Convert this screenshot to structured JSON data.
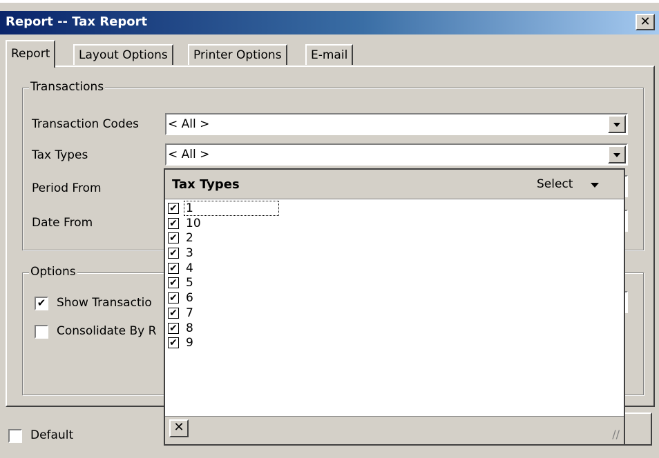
{
  "window": {
    "title": "Report -- Tax Report",
    "close_glyph": "✕"
  },
  "tabs": [
    {
      "label": "Report",
      "active": true
    },
    {
      "label": "Layout Options",
      "active": false
    },
    {
      "label": "Printer Options",
      "active": false
    },
    {
      "label": "E-mail",
      "active": false
    }
  ],
  "transactions_group": {
    "label": "Transactions",
    "transaction_codes": {
      "label": "Transaction Codes",
      "value": "< All >"
    },
    "tax_types": {
      "label": "Tax Types",
      "value": "< All >"
    },
    "period_from": {
      "label": "Period From"
    },
    "date_from": {
      "label": "Date From"
    }
  },
  "options_group": {
    "label": "Options",
    "show_transactions": {
      "label": "Show Transactio",
      "checked": "✔"
    },
    "consolidate_by": {
      "label": "Consolidate By R",
      "checked": ""
    }
  },
  "footer": {
    "default": {
      "label": "Default",
      "checked": ""
    }
  },
  "popup": {
    "title": "Tax Types",
    "select_label": "Select",
    "check_glyph": "✔",
    "close_glyph": "✕",
    "grip_glyph": "//",
    "items": [
      "1",
      "10",
      "2",
      "3",
      "4",
      "5",
      "6",
      "7",
      "8",
      "9"
    ]
  }
}
